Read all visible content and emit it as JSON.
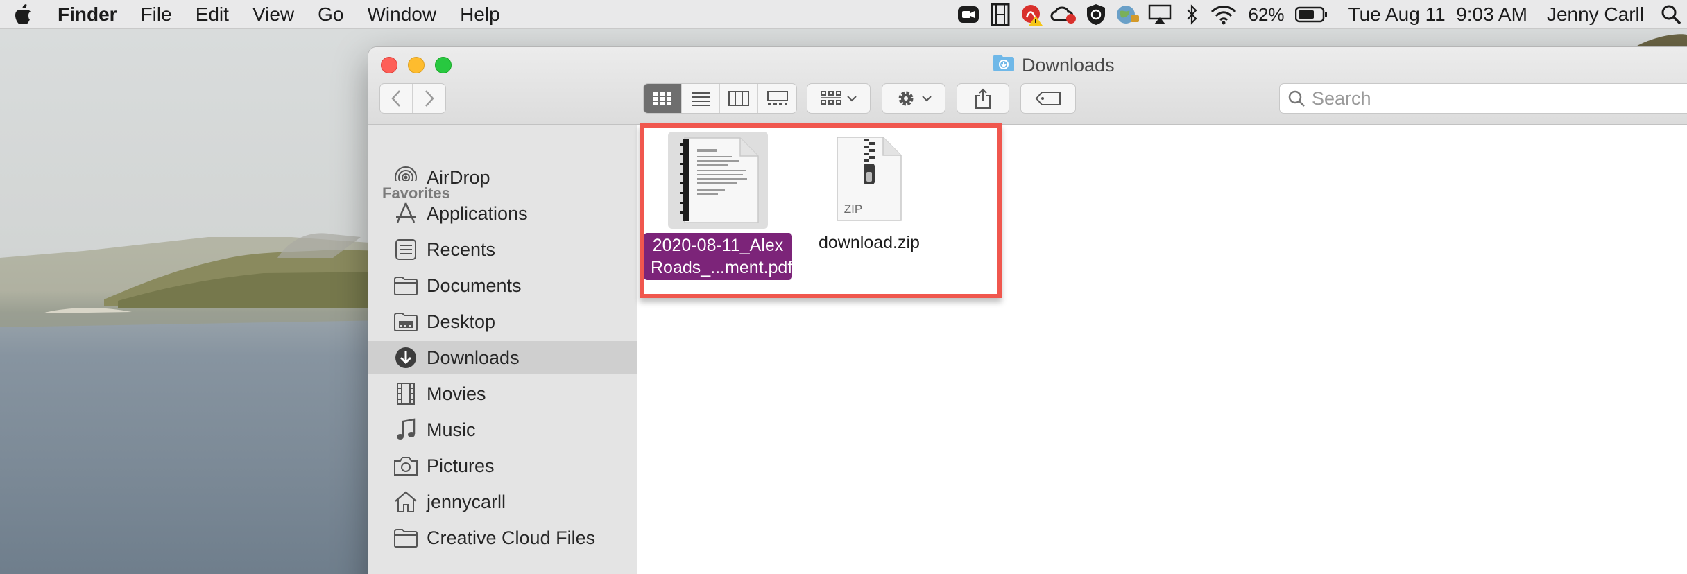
{
  "menubar": {
    "app_name": "Finder",
    "menus": [
      "File",
      "Edit",
      "View",
      "Go",
      "Window",
      "Help"
    ],
    "battery_percent": "62%",
    "datetime": "Tue Aug 11  9:03 AM",
    "user": "Jenny Carll"
  },
  "window": {
    "title": "Downloads",
    "search_placeholder": "Search"
  },
  "sidebar": {
    "section": "Favorites",
    "items": [
      {
        "label": "AirDrop",
        "icon": "airdrop-icon"
      },
      {
        "label": "Applications",
        "icon": "applications-icon"
      },
      {
        "label": "Recents",
        "icon": "recents-icon"
      },
      {
        "label": "Documents",
        "icon": "folder-icon"
      },
      {
        "label": "Desktop",
        "icon": "desktop-icon"
      },
      {
        "label": "Downloads",
        "icon": "downloads-icon",
        "selected": true
      },
      {
        "label": "Movies",
        "icon": "movies-icon"
      },
      {
        "label": "Music",
        "icon": "music-icon"
      },
      {
        "label": "Pictures",
        "icon": "camera-icon"
      },
      {
        "label": "jennycarll",
        "icon": "home-icon"
      },
      {
        "label": "Creative Cloud Files",
        "icon": "folder-icon"
      }
    ]
  },
  "files": [
    {
      "name_line1": "2020-08-11_Alex",
      "name_line2": "Roads_...ment.pdf",
      "type": "pdf",
      "selected": true
    },
    {
      "name": "download.zip",
      "type": "zip",
      "badge": "ZIP",
      "selected": false
    }
  ],
  "colors": {
    "selection": "#7c2479",
    "highlight_box": "#f0574e",
    "sidebar_bg": "#e4e4e4"
  }
}
